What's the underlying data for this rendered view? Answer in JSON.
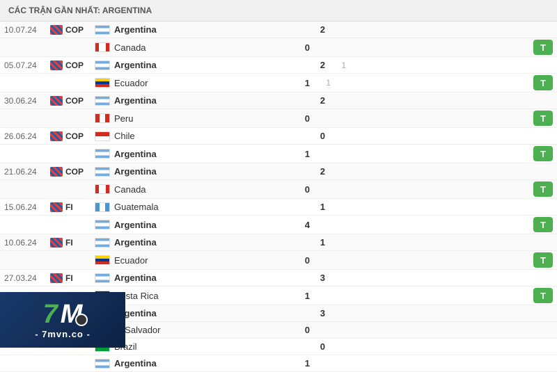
{
  "header": {
    "title": "CÁC TRẬN GẦN NHẤT: ARGENTINA"
  },
  "matches": [
    {
      "date": "10.07.24",
      "comp": "COP",
      "teams": [
        {
          "name": "Argentina",
          "flag": "argentina",
          "bold": true,
          "score": "2",
          "score2": ""
        },
        {
          "name": "Canada",
          "flag": "canada",
          "bold": false,
          "score": "0",
          "score2": ""
        }
      ],
      "hasT": true
    },
    {
      "date": "05.07.24",
      "comp": "COP",
      "teams": [
        {
          "name": "Argentina",
          "flag": "argentina",
          "bold": true,
          "score": "2",
          "score2": "1"
        },
        {
          "name": "Ecuador",
          "flag": "ecuador",
          "bold": false,
          "score": "1",
          "score2": "1"
        }
      ],
      "hasT": true
    },
    {
      "date": "30.06.24",
      "comp": "COP",
      "teams": [
        {
          "name": "Argentina",
          "flag": "argentina",
          "bold": true,
          "score": "2",
          "score2": ""
        },
        {
          "name": "Peru",
          "flag": "peru",
          "bold": false,
          "score": "0",
          "score2": ""
        }
      ],
      "hasT": true
    },
    {
      "date": "26.06.24",
      "comp": "COP",
      "teams": [
        {
          "name": "Chile",
          "flag": "chile",
          "bold": false,
          "score": "0",
          "score2": ""
        },
        {
          "name": "Argentina",
          "flag": "argentina",
          "bold": true,
          "score": "1",
          "score2": ""
        }
      ],
      "hasT": true
    },
    {
      "date": "21.06.24",
      "comp": "COP",
      "teams": [
        {
          "name": "Argentina",
          "flag": "argentina",
          "bold": true,
          "score": "2",
          "score2": ""
        },
        {
          "name": "Canada",
          "flag": "canada",
          "bold": false,
          "score": "0",
          "score2": ""
        }
      ],
      "hasT": true
    },
    {
      "date": "15.06.24",
      "comp": "FI",
      "teams": [
        {
          "name": "Guatemala",
          "flag": "guatemala",
          "bold": false,
          "score": "1",
          "score2": ""
        },
        {
          "name": "Argentina",
          "flag": "argentina",
          "bold": true,
          "score": "4",
          "score2": ""
        }
      ],
      "hasT": true
    },
    {
      "date": "10.06.24",
      "comp": "FI",
      "teams": [
        {
          "name": "Argentina",
          "flag": "argentina",
          "bold": true,
          "score": "1",
          "score2": ""
        },
        {
          "name": "Ecuador",
          "flag": "ecuador",
          "bold": false,
          "score": "0",
          "score2": ""
        }
      ],
      "hasT": true
    },
    {
      "date": "27.03.24",
      "comp": "FI",
      "teams": [
        {
          "name": "Argentina",
          "flag": "argentina",
          "bold": true,
          "score": "3",
          "score2": ""
        },
        {
          "name": "Costa Rica",
          "flag": "costarica",
          "bold": false,
          "score": "1",
          "score2": ""
        }
      ],
      "hasT": true
    },
    {
      "date": "",
      "comp": "",
      "teams": [
        {
          "name": "Argentina",
          "flag": "argentina",
          "bold": true,
          "score": "3",
          "score2": ""
        },
        {
          "name": "El Salvador",
          "flag": "elsalvador",
          "bold": false,
          "score": "0",
          "score2": ""
        }
      ],
      "hasT": false
    },
    {
      "date": "",
      "comp": "",
      "teams": [
        {
          "name": "Brazil",
          "flag": "brazil",
          "bold": false,
          "score": "0",
          "score2": ""
        },
        {
          "name": "Argentina",
          "flag": "argentina",
          "bold": true,
          "score": "1",
          "score2": ""
        }
      ],
      "hasT": false
    }
  ],
  "buttons": {
    "t_label": "T"
  },
  "watermark": {
    "seven": "7",
    "m": "M",
    "domain": "- 7mvn.co -"
  }
}
